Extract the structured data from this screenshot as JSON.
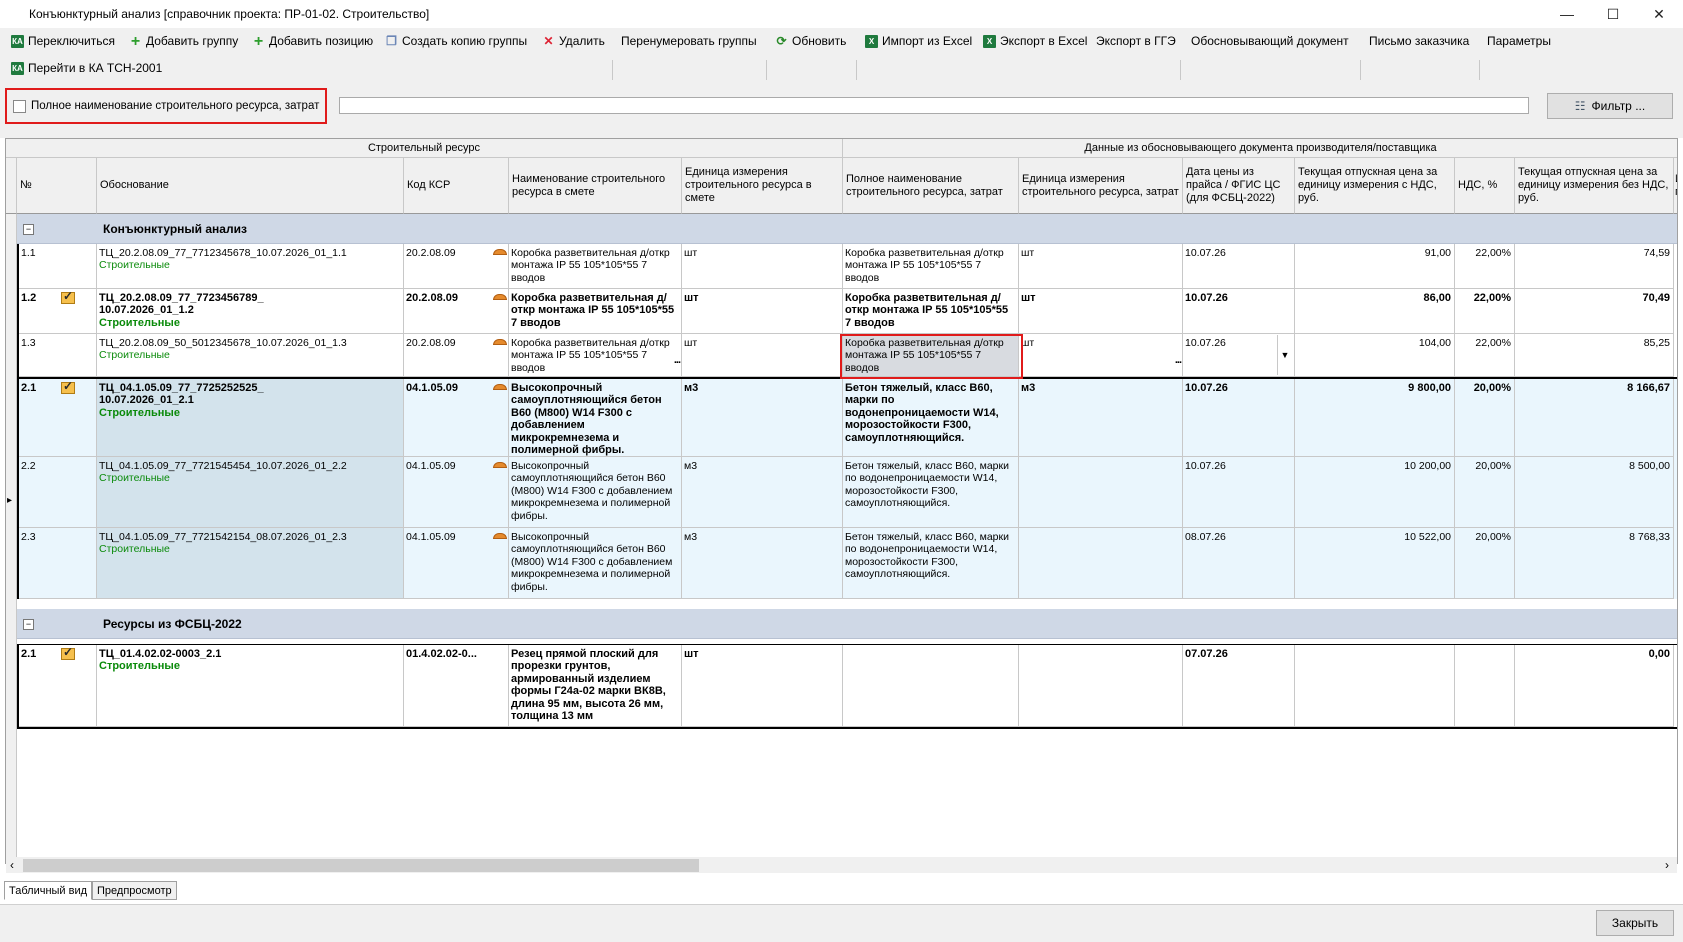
{
  "window": {
    "title": "Конъюнктурный анализ [справочник проекта: ПР-01-02. Строительство]",
    "minimize": "—",
    "maximize": "☐",
    "close": "✕"
  },
  "toolbar": {
    "switch": "Переключиться",
    "add_group": "Добавить группу",
    "add_position": "Добавить позицию",
    "copy_group": "Создать копию группы",
    "delete": "Удалить",
    "renumber": "Перенумеровать группы",
    "refresh": "Обновить",
    "import_excel": "Импорт из Excel",
    "export_excel": "Экспорт в Excel",
    "export_gge": "Экспорт в ГГЭ",
    "justifying_doc": "Обосновывающий документ",
    "customer_letter": "Письмо заказчика",
    "parameters": "Параметры",
    "goto_ka": "Перейти в КА ТСН-2001"
  },
  "filter": {
    "checkbox_label": "Полное наименование строительного ресурса, затрат",
    "input_value": "",
    "button_label": "Фильтр ..."
  },
  "grid": {
    "bands": {
      "resource": "Строительный ресурс",
      "supplier": "Данные из обосновывающего документа производителя/поставщика"
    },
    "columns": {
      "num": "№",
      "basis": "Обоснование",
      "ksr": "Код КСР",
      "name": "Наименование строительного ресурса в смете",
      "unit": "Единица измерения строительного ресурса в смете",
      "full_name": "Полное наименование строительного ресурса, затрат",
      "unit_doc": "Единица измерения строительного ресурса, затрат",
      "date": "Дата цены из прайса / ФГИС ЦС (для ФСБЦ-2022)",
      "price_vat": "Текущая отпускная цена за единицу измерения с НДС, руб.",
      "vat": "НДС, %",
      "price_novat": "Текущая отпускная цена за единицу измерения без НДС, руб.",
      "extra": "И п"
    },
    "groups": [
      {
        "toggle": "−",
        "title": "Конъюнктурный анализ",
        "rows": [
          {
            "num": "1.1",
            "basis": "ТЦ_20.2.08.09_77_7712345678_10.07.2026_01_1.1",
            "category": "Строительные",
            "ksr": "20.2.08.09",
            "name": "Коробка разветвительная д/откр монтажа IP 55 105*105*55 7 вводов",
            "unit": "шт",
            "full_name": "Коробка разветвительная д/откр монтажа IP 55 105*105*55 7 вводов",
            "unit_doc": "шт",
            "date": "10.07.26",
            "price_vat": "91,00",
            "vat": "22,00%",
            "price_novat": "74,59"
          },
          {
            "num": "1.2",
            "basis": "ТЦ_20.2.08.09_77_7723456789_10.07.2026_01_1.2",
            "category": "Строительные",
            "ksr": "20.2.08.09",
            "name": "Коробка разветвительная д/откр монтажа IP 55 105*105*55 7 вводов",
            "unit": "шт",
            "full_name": "Коробка разветвительная д/откр монтажа IP 55 105*105*55 7 вводов",
            "unit_doc": "шт",
            "date": "10.07.26",
            "price_vat": "86,00",
            "vat": "22,00%",
            "price_novat": "70,49"
          },
          {
            "num": "1.3",
            "basis": "ТЦ_20.2.08.09_50_5012345678_10.07.2026_01_1.3",
            "category": "Строительные",
            "ksr": "20.2.08.09",
            "name": "Коробка разветвительная д/откр монтажа IP 55 105*105*55 7 вводов",
            "unit": "шт",
            "full_name": "Коробка разветвительная д/откр монтажа IP 55 105*105*55 7 вводов",
            "unit_doc": "шт",
            "date": "10.07.26",
            "price_vat": "104,00",
            "vat": "22,00%",
            "price_novat": "85,25"
          },
          {
            "num": "2.1",
            "basis": "ТЦ_04.1.05.09_77_7725252525_10.07.2026_01_2.1",
            "category": "Строительные",
            "ksr": "04.1.05.09",
            "name": "Высокопрочный самоуплотняющийся бетон В60 (М800) W14 F300 с добавлением микрокремнезема и полимерной фибры.",
            "unit": "м3",
            "full_name": " Бетон тяжелый, класс В60, марки по водонепроницаемости W14, морозостойкости F300, самоуплотняющийся.",
            "unit_doc": "м3",
            "date": "10.07.26",
            "price_vat": "9 800,00",
            "vat": "20,00%",
            "price_novat": "8 166,67"
          },
          {
            "num": "2.2",
            "basis": "ТЦ_04.1.05.09_77_7721545454_10.07.2026_01_2.2",
            "category": "Строительные",
            "ksr": "04.1.05.09",
            "name": "Высокопрочный самоуплотняющийся бетон В60 (М800) W14 F300 с добавлением микрокремнезема и полимерной фибры.",
            "unit": "м3",
            "full_name": " Бетон тяжелый, класс В60, марки по водонепроницаемости W14, морозостойкости F300, самоуплотняющийся.",
            "unit_doc": "",
            "date": "10.07.26",
            "price_vat": "10 200,00",
            "vat": "20,00%",
            "price_novat": "8 500,00"
          },
          {
            "num": "2.3",
            "basis": "ТЦ_04.1.05.09_77_7721542154_08.07.2026_01_2.3",
            "category": "Строительные",
            "ksr": "04.1.05.09",
            "name": "Высокопрочный самоуплотняющийся бетон В60 (М800) W14 F300 с добавлением микрокремнезема и полимерной фибры.",
            "unit": "м3",
            "full_name": " Бетон тяжелый, класс В60, марки по водонепроницаемости W14, морозостойкости F300, самоуплотняющийся.",
            "unit_doc": "",
            "date": "08.07.26",
            "price_vat": "10 522,00",
            "vat": "20,00%",
            "price_novat": "8 768,33"
          }
        ]
      },
      {
        "toggle": "−",
        "title": "Ресурсы из ФСБЦ-2022",
        "rows": [
          {
            "num": "2.1",
            "basis": "ТЦ_01.4.02.02-0003_2.1",
            "category": "Строительные",
            "ksr": "01.4.02.02-0...",
            "name": "Резец прямой плоский для прорезки грунтов, армированный изделием формы Г24а-02 марки ВК8В, длина 95 мм, высота 26 мм, толщина 13 мм",
            "unit": "шт",
            "full_name": "",
            "unit_doc": "",
            "date": "07.07.26",
            "price_vat": "",
            "vat": "",
            "price_novat": "0,00"
          }
        ]
      }
    ],
    "ellipsis": "...",
    "dropdown_arrow": "▼"
  },
  "tabs": [
    "Табличный вид",
    "Предпросмотр"
  ],
  "footer": {
    "close_button": "Закрыть"
  },
  "scroll": {
    "left_arrow": "‹",
    "right_arrow": "›"
  }
}
